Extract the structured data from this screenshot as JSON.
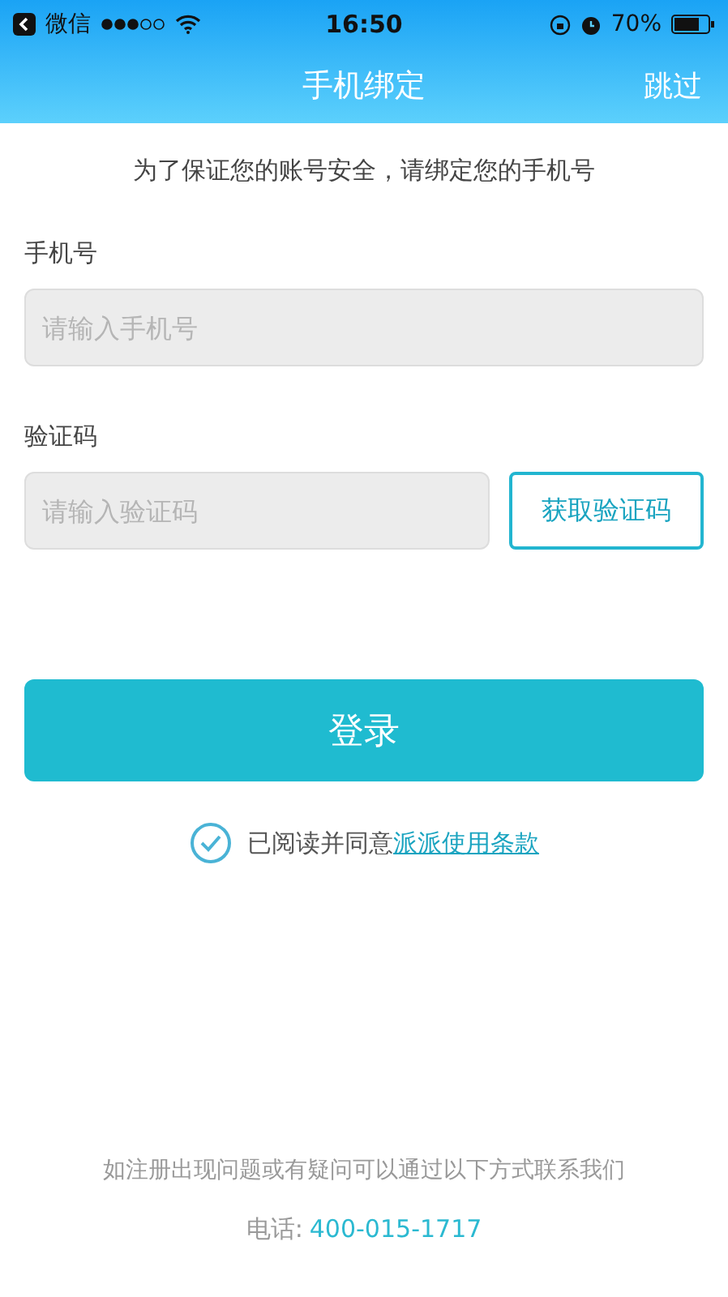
{
  "status_bar": {
    "carrier": "微信",
    "time": "16:50",
    "battery": "70%"
  },
  "nav": {
    "title": "手机绑定",
    "action": "跳过"
  },
  "notice": "为了保证您的账号安全，请绑定您的手机号",
  "phone_field": {
    "label": "手机号",
    "placeholder": "请输入手机号"
  },
  "code_field": {
    "label": "验证码",
    "placeholder": "请输入验证码",
    "button": "获取验证码"
  },
  "login_button": "登录",
  "agreement": {
    "checked": true,
    "text": "已阅读并同意",
    "link": "派派使用条款"
  },
  "footer": {
    "help": "如注册出现问题或有疑问可以通过以下方式联系我们",
    "phone_label": "电话:",
    "phone": "400-015-1717"
  }
}
